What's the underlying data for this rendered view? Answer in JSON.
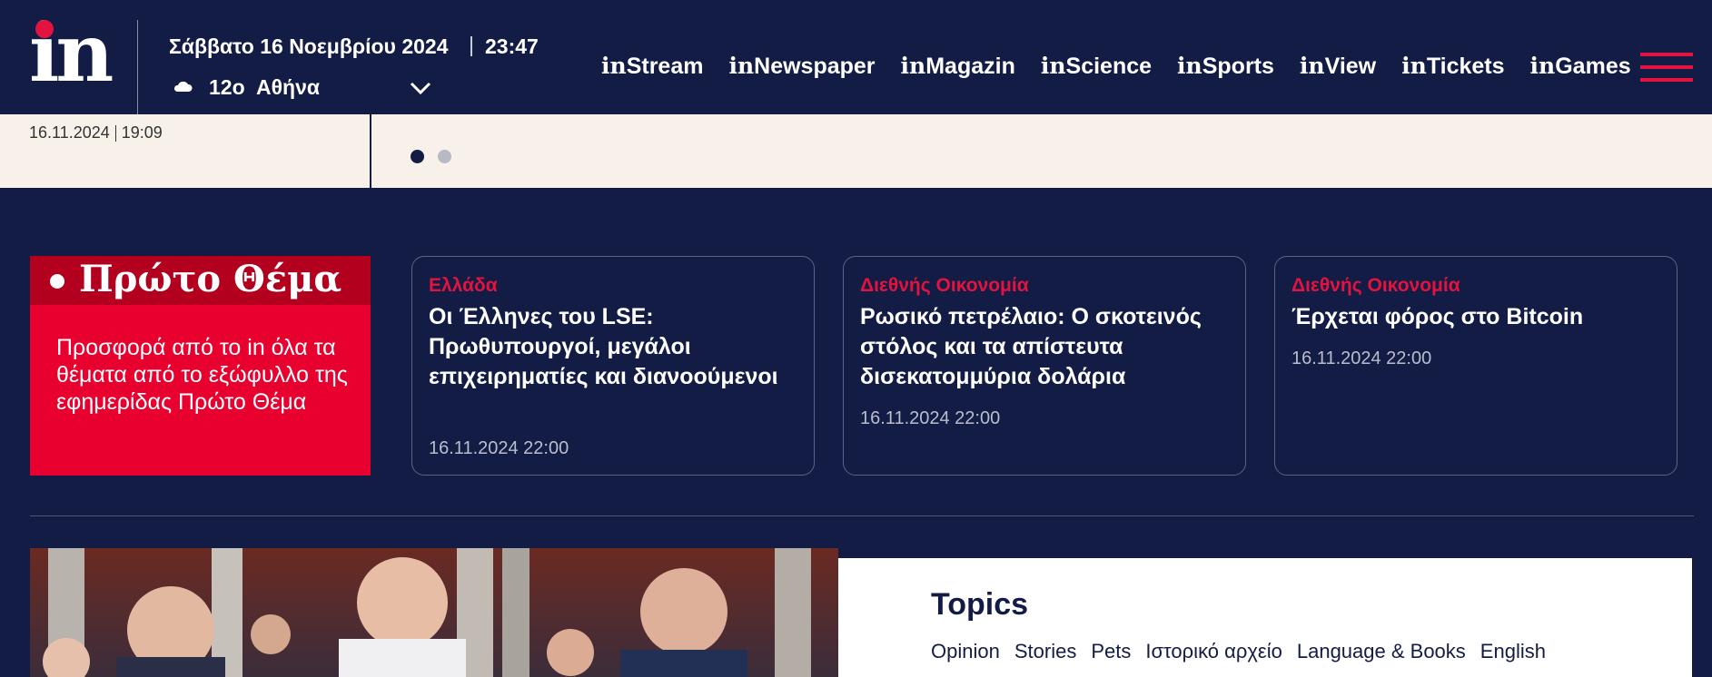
{
  "header": {
    "date": "Σάββατο 16 Νοεμβρίου 2024",
    "time": "23:47",
    "temperature": "12o",
    "city": "Αθήνα",
    "logo_text": "in",
    "nav": [
      {
        "prefix": "in",
        "label": "Stream"
      },
      {
        "prefix": "in",
        "label": "Newspaper"
      },
      {
        "prefix": "in",
        "label": "Magazin"
      },
      {
        "prefix": "in",
        "label": "Science"
      },
      {
        "prefix": "in",
        "label": "Sports"
      },
      {
        "prefix": "in",
        "label": "View"
      },
      {
        "prefix": "in",
        "label": "Tickets"
      },
      {
        "prefix": "in",
        "label": "Games"
      }
    ]
  },
  "strip": {
    "date": "16.11.2024",
    "time": "19:09"
  },
  "promo": {
    "title": "Πρώτο Θέμα",
    "body": "Προσφορά από το in όλα τα θέματα από το εξώφυλλο της εφημερίδας Πρώτο Θέμα"
  },
  "cards": [
    {
      "category": "Ελλάδα",
      "title": "Οι Έλληνες του LSE: Πρωθυπουργοί, μεγάλοι επιχειρηματίες και διανοούμενοι",
      "date": "16.11.2024 22:00"
    },
    {
      "category": "Διεθνής Οικονομία",
      "title": "Ρωσικό πετρέλαιο: Ο σκοτεινός στόλος και τα απίστευτα δισεκατομμύρια δολάρια",
      "date": "16.11.2024 22:00"
    },
    {
      "category": "Διεθνής Οικονομία",
      "title": "Έρχεται φόρος στο Bitcoin",
      "date": "16.11.2024 22:00"
    }
  ],
  "topics": {
    "title": "Topics",
    "items": [
      "Opinion",
      "Stories",
      "Pets",
      "Ιστορικό αρχείο",
      "Language & Books",
      "English"
    ]
  },
  "colors": {
    "navy": "#131c45",
    "red": "#e2133f",
    "cream": "#f7f1ea"
  },
  "icons": {
    "weather": "cloud-icon",
    "city_dropdown": "chevron-down-icon",
    "menu": "hamburger-menu-icon"
  }
}
